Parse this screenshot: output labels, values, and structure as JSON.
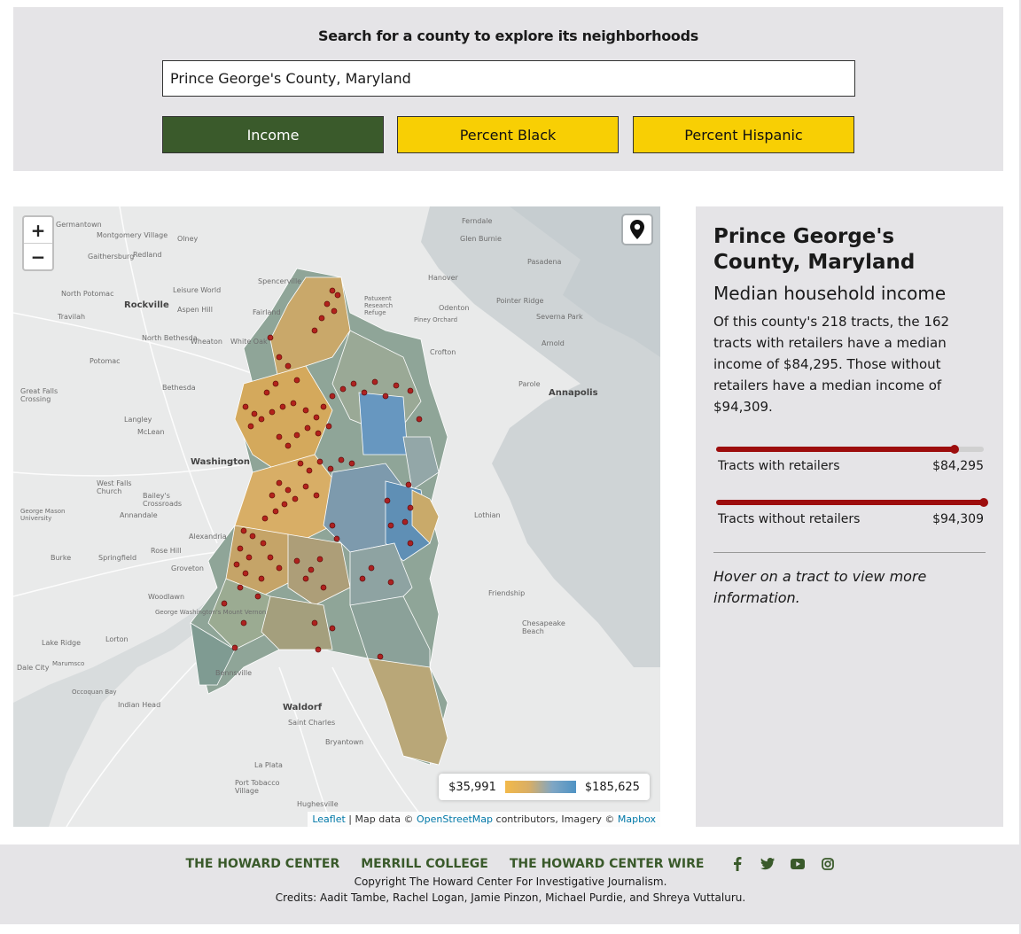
{
  "search": {
    "heading": "Search for a county to explore its neighborhoods",
    "value": "Prince George's County, Maryland",
    "buttons": [
      "Income",
      "Percent Black",
      "Percent Hispanic"
    ]
  },
  "map": {
    "zoom_in": "+",
    "zoom_out": "−",
    "labels": [
      "Germantown",
      "Montgomery Village",
      "Gaithersburg",
      "Redland",
      "Olney",
      "Spencerville",
      "North Potomac",
      "Rockville",
      "Leisure World",
      "Aspen Hill",
      "Fairland",
      "Travilah",
      "North Bethesda",
      "Wheaton",
      "White Oak",
      "Potomac",
      "Bethesda",
      "Great Falls Crossing",
      "Langley",
      "McLean",
      "Washington",
      "West Falls Church",
      "Bailey's Crossroads",
      "Annandale",
      "George Mason University",
      "Alexandria",
      "Springfield",
      "Burke",
      "Rose Hill",
      "Groveton",
      "Woodlawn",
      "George Washington's Mount Vernon",
      "Lake Ridge",
      "Lorton",
      "Dale City",
      "Marumsco",
      "Occoquan Bay",
      "Indian Head",
      "Bennsville",
      "Waldorf",
      "Saint Charles",
      "Bryantown",
      "La Plata",
      "Port Tobacco Village",
      "Hughesville",
      "Chesapeake Beach",
      "Friendship",
      "Lothian",
      "Annapolis",
      "Parole",
      "Pasadena",
      "Severna Park",
      "Glen Burnie",
      "Ferndale",
      "Arnold",
      "Odenton",
      "Crofton",
      "Pointer Ridge",
      "Patuxent Research Refuge",
      "Piney Orchard",
      "Hanover",
      "Odenton"
    ],
    "legend": {
      "min": "$35,991",
      "max": "$185,625",
      "min_color": "#f2b94a",
      "max_color": "#4f93c4"
    },
    "attribution": {
      "leaflet": "Leaflet",
      "sep1": "| Map data ©",
      "osm": "OpenStreetMap",
      "mid": "contributors, Imagery ©",
      "mapbox": "Mapbox"
    }
  },
  "info": {
    "title": "Prince George's County, Maryland",
    "subtitle": "Median household income",
    "paragraph": "Of this county's 218 tracts, the 162 tracts with retailers have a median income of $84,295. Those without retailers have a median income of $94,309.",
    "bars": [
      {
        "label": "Tracts with retailers",
        "value": "$84,295",
        "fraction": 0.89
      },
      {
        "label": "Tracts without retailers",
        "value": "$94,309",
        "fraction": 1.0
      }
    ],
    "hint": "Hover on a tract to view more information.",
    "accent": "#9d0d0d"
  },
  "footer": {
    "links": [
      "THE HOWARD CENTER",
      "MERRILL COLLEGE",
      "THE HOWARD CENTER WIRE"
    ],
    "social": [
      "facebook-icon",
      "twitter-icon",
      "youtube-icon",
      "instagram-icon"
    ],
    "copyright": "Copyright The Howard Center For Investigative Journalism.",
    "credits": "Credits: Aadit Tambe, Rachel Logan, Jamie Pinzon, Michael Purdie, and Shreya Vuttaluru.",
    "link_color": "#3a5a2b"
  }
}
